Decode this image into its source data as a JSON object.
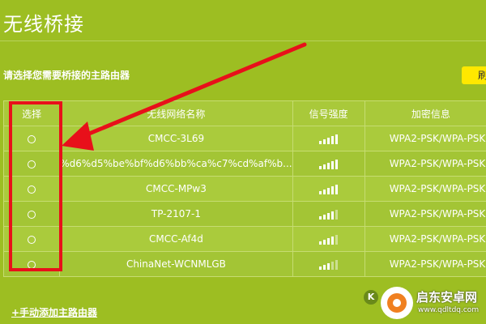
{
  "page": {
    "title": "无线桥接",
    "instruction": "请选择您需要桥接的主路由器",
    "refresh_label": "刷新",
    "add_link": "+手动添加主路由器",
    "back_icon_label": "K"
  },
  "table": {
    "headers": {
      "select": "选择",
      "ssid": "无线网络名称",
      "signal": "信号强度",
      "encryption": "加密信息"
    },
    "rows": [
      {
        "ssid": "CMCC-3L69",
        "signal_bars": 5,
        "encryption": "WPA2-PSK/WPA-PSK"
      },
      {
        "ssid": "%d6%d5%be%bf%d6%bb%ca%c7%cd%af%b...",
        "signal_bars": 5,
        "encryption": "WPA2-PSK/WPA-PSK"
      },
      {
        "ssid": "CMCC-MPw3",
        "signal_bars": 5,
        "encryption": "WPA2-PSK/WPA-PSK"
      },
      {
        "ssid": "TP-2107-1",
        "signal_bars": 4,
        "encryption": "WPA2-PSK/WPA-PSK"
      },
      {
        "ssid": "CMCC-Af4d",
        "signal_bars": 4,
        "encryption": "WPA2-PSK/WPA-PSK"
      },
      {
        "ssid": "ChinaNet-WCNMLGB",
        "signal_bars": 3,
        "encryption": "WPA2-PSK/WPA-PSK"
      }
    ]
  },
  "watermark": {
    "name": "启东安卓网",
    "url": "www.qdltdq.com"
  },
  "colors": {
    "background": "#9dbe22",
    "refresh_button": "#ffe800",
    "annotation_red": "#e8101a"
  }
}
